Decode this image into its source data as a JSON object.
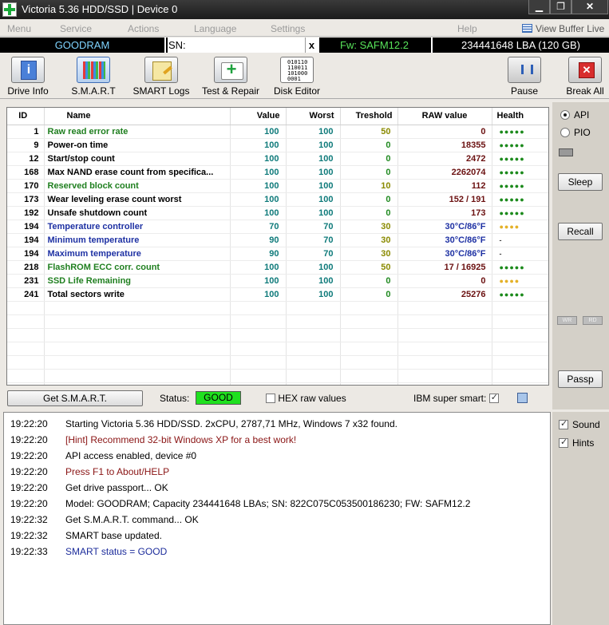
{
  "window": {
    "title": "Victoria 5.36 HDD/SSD | Device 0",
    "minimize": "▁",
    "maximize": "❐",
    "close": "✕"
  },
  "menu": {
    "items": [
      "Menu",
      "Service",
      "Actions",
      "Language",
      "Settings",
      "Help"
    ],
    "view_buffer": "View Buffer Live"
  },
  "drive": {
    "model": "GOODRAM",
    "serial": "SN: 822C075C053500186230",
    "serial_close": "x",
    "firmware": "Fw: SAFM12.2",
    "capacity": "234441648 LBA (120 GB)"
  },
  "toolbar": {
    "drive_info": "Drive Info",
    "smart": "S.M.A.R.T",
    "smart_logs": "SMART Logs",
    "test_repair": "Test & Repair",
    "disk_editor": "Disk Editor",
    "disk_editor_bits": "010110\n110011\n101000\n0001",
    "pause": "Pause",
    "break_all": "Break All"
  },
  "table": {
    "headers": {
      "id": "ID",
      "name": "Name",
      "value": "Value",
      "worst": "Worst",
      "treshold": "Treshold",
      "raw": "RAW value",
      "health": "Health"
    },
    "rows": [
      {
        "id": "1",
        "name": "Raw read error rate",
        "value": "100",
        "worst": "100",
        "treshold": "50",
        "raw": "0",
        "health": "●●●●●"
      },
      {
        "id": "9",
        "name": "Power-on time",
        "value": "100",
        "worst": "100",
        "treshold": "0",
        "raw": "18355",
        "health": "●●●●●"
      },
      {
        "id": "12",
        "name": "Start/stop count",
        "value": "100",
        "worst": "100",
        "treshold": "0",
        "raw": "2472",
        "health": "●●●●●"
      },
      {
        "id": "168",
        "name": "Max NAND erase count from specifica...",
        "value": "100",
        "worst": "100",
        "treshold": "0",
        "raw": "2262074",
        "health": "●●●●●"
      },
      {
        "id": "170",
        "name": "Reserved block count",
        "value": "100",
        "worst": "100",
        "treshold": "10",
        "raw": "112",
        "health": "●●●●●"
      },
      {
        "id": "173",
        "name": "Wear leveling erase count worst",
        "value": "100",
        "worst": "100",
        "treshold": "0",
        "raw": "152 / 191",
        "health": "●●●●●"
      },
      {
        "id": "192",
        "name": "Unsafe shutdown count",
        "value": "100",
        "worst": "100",
        "treshold": "0",
        "raw": "173",
        "health": "●●●●●"
      },
      {
        "id": "194",
        "name": "Temperature controller",
        "value": "70",
        "worst": "70",
        "treshold": "30",
        "raw": "30°C/86°F",
        "health": "●●●●"
      },
      {
        "id": "194",
        "name": "Minimum temperature",
        "value": "90",
        "worst": "70",
        "treshold": "30",
        "raw": "30°C/86°F",
        "health": "-"
      },
      {
        "id": "194",
        "name": "Maximum temperature",
        "value": "90",
        "worst": "70",
        "treshold": "30",
        "raw": "30°C/86°F",
        "health": "-"
      },
      {
        "id": "218",
        "name": "FlashROM ECC corr. count",
        "value": "100",
        "worst": "100",
        "treshold": "50",
        "raw": "17 / 16925",
        "health": "●●●●●"
      },
      {
        "id": "231",
        "name": "SSD Life Remaining",
        "value": "100",
        "worst": "100",
        "treshold": "0",
        "raw": "0",
        "health": "●●●●"
      },
      {
        "id": "241",
        "name": "Total sectors write",
        "value": "100",
        "worst": "100",
        "treshold": "0",
        "raw": "25276",
        "health": "●●●●●"
      }
    ]
  },
  "side": {
    "api": "API",
    "pio": "PIO",
    "sleep": "Sleep",
    "recall": "Recall",
    "wr1": "WR",
    "wr2": "RD",
    "passp": "Passp"
  },
  "status": {
    "get_smart": "Get S.M.A.R.T.",
    "label": "Status:",
    "value": "GOOD",
    "hex_raw": "HEX raw values",
    "ibm": "IBM super smart:"
  },
  "log": [
    {
      "time": "19:22:20",
      "text": "Starting Victoria 5.36 HDD/SSD. 2xCPU, 2787,71 MHz, Windows 7 x32 found.",
      "color": "black"
    },
    {
      "time": "19:22:20",
      "text": "[Hint] Recommend 32-bit Windows XP for a best work!",
      "color": "red"
    },
    {
      "time": "19:22:20",
      "text": "API access enabled, device #0",
      "color": "black"
    },
    {
      "time": "19:22:20",
      "text": "Press F1 to About/HELP",
      "color": "red"
    },
    {
      "time": "19:22:20",
      "text": "Get drive passport... OK",
      "color": "black"
    },
    {
      "time": "19:22:20",
      "text": "Model: GOODRAM; Capacity 234441648 LBAs; SN: 822C075C053500186230; FW: SAFM12.2",
      "color": "black"
    },
    {
      "time": "19:22:32",
      "text": "Get S.M.A.R.T. command... OK",
      "color": "black"
    },
    {
      "time": "19:22:32",
      "text": "SMART base updated.",
      "color": "black"
    },
    {
      "time": "19:22:33",
      "text": "SMART status = GOOD",
      "color": "blue"
    }
  ],
  "log_side": {
    "sound": "Sound",
    "hints": "Hints"
  },
  "colors": {
    "status_good": "#1fe01f",
    "model_text": "#7fd4ff",
    "firmware_text": "#58e35a"
  }
}
